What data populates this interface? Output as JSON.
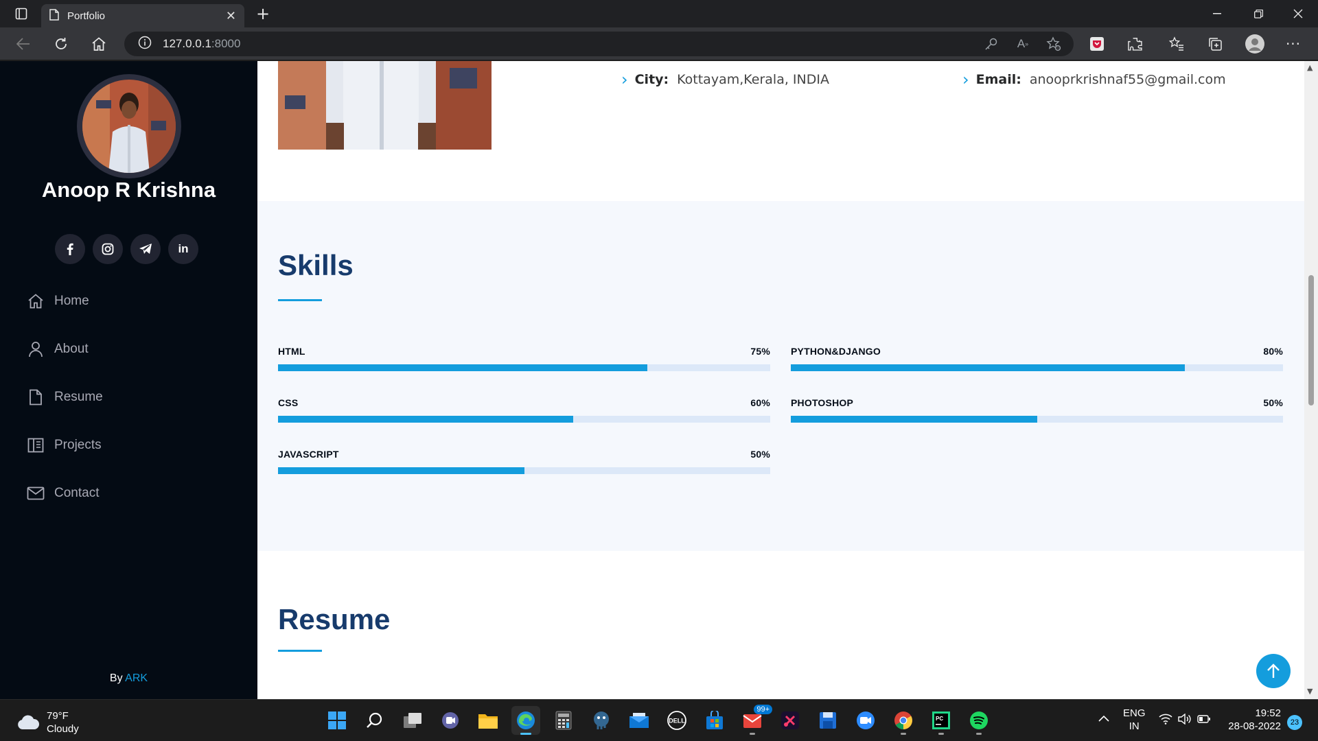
{
  "browser": {
    "tab_title": "Portfolio",
    "url_host": "127.0.0.1",
    "url_port": ":8000"
  },
  "sidebar": {
    "name": "Anoop R Krishna",
    "socials": [
      "facebook",
      "instagram",
      "telegram",
      "linkedin"
    ],
    "linkedin_label": "in",
    "nav": [
      {
        "label": "Home",
        "icon": "home-icon"
      },
      {
        "label": "About",
        "icon": "person-icon"
      },
      {
        "label": "Resume",
        "icon": "file-icon"
      },
      {
        "label": "Projects",
        "icon": "book-icon"
      },
      {
        "label": "Contact",
        "icon": "envelope-icon"
      }
    ],
    "footer_prefix": "By ",
    "footer_link": "ARK"
  },
  "about": {
    "city_label": "City:",
    "city_value": "Kottayam,Kerala, INDIA",
    "email_label": "Email:",
    "email_value": "anooprkrishnaf55@gmail.com"
  },
  "skills": {
    "title": "Skills",
    "items": [
      {
        "name": "HTML",
        "percent_label": "75%",
        "value": 75
      },
      {
        "name": "PYTHON&DJANGO",
        "percent_label": "80%",
        "value": 80
      },
      {
        "name": "CSS",
        "percent_label": "60%",
        "value": 60
      },
      {
        "name": "PHOTOSHOP",
        "percent_label": "50%",
        "value": 50
      },
      {
        "name": "JAVASCRIPT",
        "percent_label": "50%",
        "value": 50
      }
    ]
  },
  "resume": {
    "title": "Resume"
  },
  "taskbar": {
    "temperature": "79°F",
    "condition": "Cloudy",
    "mail_badge": "99+",
    "language": "ENG",
    "region": "IN",
    "time": "19:52",
    "date": "28-08-2022",
    "notifications": "23"
  },
  "colors": {
    "accent": "#149ddd",
    "sidebar_bg": "#040b14",
    "heading": "#173b6c",
    "skills_bg": "#f5f8fd"
  }
}
